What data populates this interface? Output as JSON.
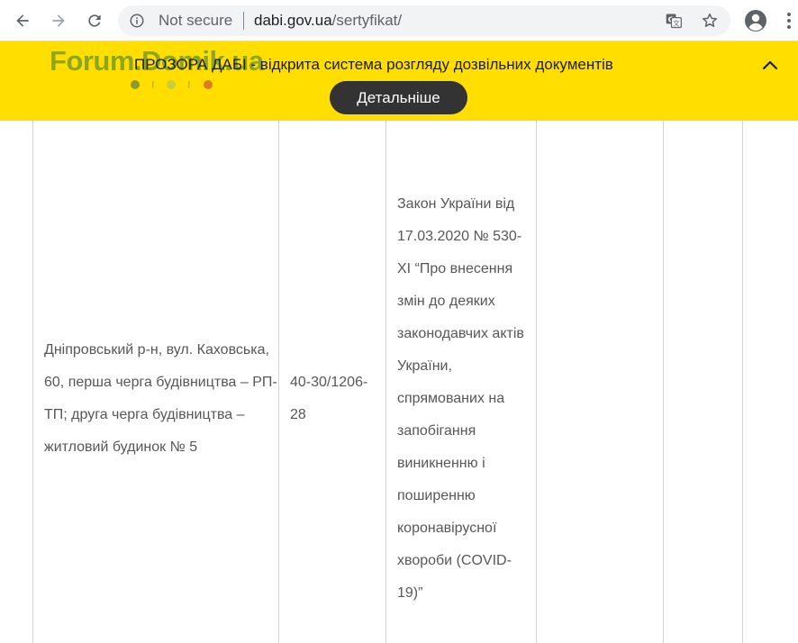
{
  "browser": {
    "security_label": "Not secure",
    "url_host": "dabi.gov.ua",
    "url_path": "/sertyfikat/",
    "icons": [
      "back-arrow-icon",
      "forward-arrow-icon",
      "reload-icon",
      "info-icon",
      "translate-icon",
      "star-icon",
      "profile-icon",
      "kebab-menu-icon"
    ]
  },
  "banner": {
    "watermark": "Forum.Domik.ua",
    "text": "ПРОЗОРА ДАБІ - відкрита система розгляду дозвільних документів",
    "button_label": "Детальніше",
    "background_color": "#ffde00",
    "dot_colors": [
      "#8c9a2e",
      "#c8cf3a",
      "#e07a1f"
    ]
  },
  "table": {
    "address_lines": [
      "Дніпровський р-н, вул. Каховська,",
      "60, перша черга будівництва – РП-",
      "ТП; друга черга будівництва –",
      "житловий будинок № 5"
    ],
    "number_lines": [
      "40-30/1206-",
      "28"
    ],
    "law_lines": [
      "Закон України від",
      "17.03.2020 № 530-",
      "ХІ “Про внесення",
      "змін до деяких",
      "законодавчих актів",
      "України,",
      "спрямованих на",
      "запобігання",
      "виникненню і",
      "поширенню",
      "коронавірусної",
      "хвороби (COVID-",
      "19)”"
    ]
  }
}
